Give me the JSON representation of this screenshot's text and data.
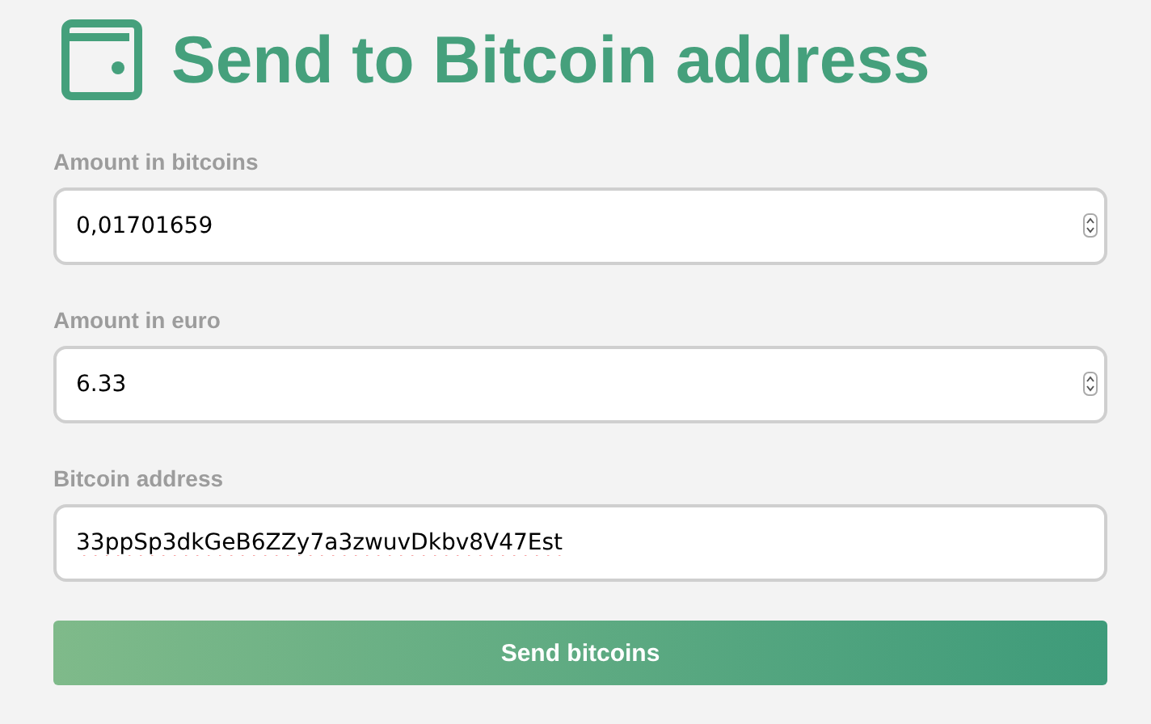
{
  "title": "Send to Bitcoin address",
  "fields": [
    {
      "label": "Amount in bitcoins",
      "value": "0,01701659",
      "kind": "number",
      "misspelled": false
    },
    {
      "label": "Amount in euro",
      "value": "6.33",
      "kind": "number",
      "misspelled": false
    },
    {
      "label": "Bitcoin address",
      "value": "33ppSp3dkGeB6ZZy7a3zwuvDkbv8V47Est",
      "kind": "text",
      "misspelled": true
    }
  ],
  "button": "Send bitcoins"
}
